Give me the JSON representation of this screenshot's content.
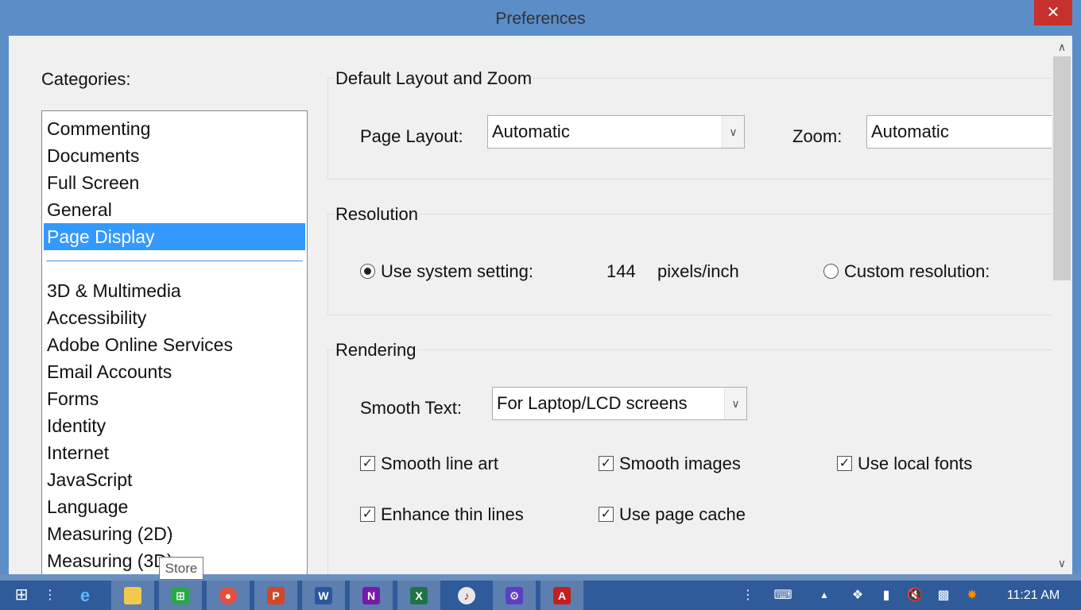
{
  "window": {
    "title": "Preferences",
    "close_glyph": "✕"
  },
  "categories": {
    "label": "Categories:",
    "top_items": [
      "Commenting",
      "Documents",
      "Full Screen",
      "General",
      "Page Display"
    ],
    "selected": "Page Display",
    "items": [
      "3D & Multimedia",
      "Accessibility",
      "Adobe Online Services",
      "Email Accounts",
      "Forms",
      "Identity",
      "Internet",
      "JavaScript",
      "Language",
      "Measuring (2D)",
      "Measuring (3D)"
    ]
  },
  "layout_zoom": {
    "title": "Default Layout and Zoom",
    "page_layout_label": "Page Layout:",
    "page_layout_value": "Automatic",
    "zoom_label": "Zoom:",
    "zoom_value": "Automatic"
  },
  "resolution": {
    "title": "Resolution",
    "system_label": "Use system setting:",
    "system_checked": true,
    "value": "144",
    "unit": "pixels/inch",
    "custom_label": "Custom resolution:",
    "custom_checked": false
  },
  "rendering": {
    "title": "Rendering",
    "smooth_text_label": "Smooth Text:",
    "smooth_text_value": "For Laptop/LCD screens",
    "checkboxes": [
      {
        "label": "Smooth line art",
        "checked": true
      },
      {
        "label": "Smooth images",
        "checked": true
      },
      {
        "label": "Use local fonts",
        "checked": true
      },
      {
        "label": "Enhance thin lines",
        "checked": true
      },
      {
        "label": "Use page cache",
        "checked": true
      }
    ]
  },
  "tooltip": "Store",
  "taskbar": {
    "apps": [
      "start-icon",
      "task-view-icon",
      "internet-explorer-icon",
      "file-explorer-icon",
      "store-icon",
      "chrome-icon",
      "powerpoint-icon",
      "word-icon",
      "onenote-icon",
      "excel-icon",
      "itunes-icon",
      "settings-icon",
      "acrobat-icon"
    ],
    "clock": "11:21 AM"
  },
  "colors": {
    "accent": "#3399ff",
    "title_bar": "#5b8dc9",
    "close": "#c7302c",
    "taskbar": "#2f5b9a"
  }
}
